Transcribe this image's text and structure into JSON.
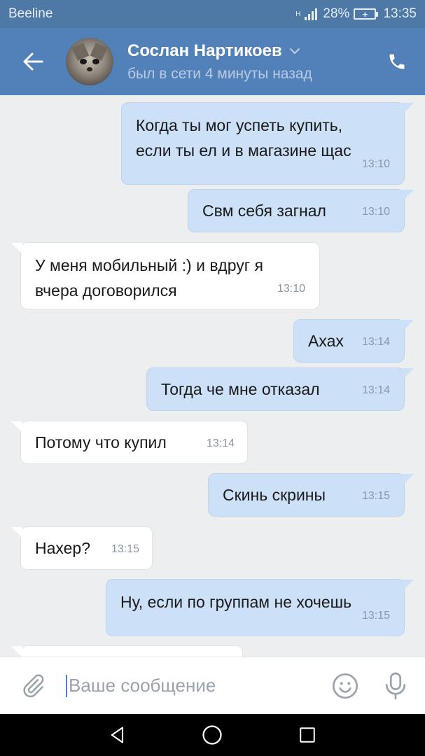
{
  "status_bar": {
    "carrier": "Beeline",
    "network": "H",
    "battery": "28%",
    "time": "13:35"
  },
  "header": {
    "contact_name": "Сослан Нартикоев",
    "contact_status": "был в сети 4 минуты назад",
    "icons": {
      "back": "arrow-left-icon",
      "dropdown": "chevron-down-icon",
      "call": "phone-icon"
    }
  },
  "messages": [
    {
      "direction": "out",
      "text_lines": [
        "Когда ты мог успеть купить,",
        "если ты ел и в магазине щас"
      ],
      "time": "13:10"
    },
    {
      "direction": "out",
      "text_lines": [
        "Свм себя загнал"
      ],
      "time": "13:10"
    },
    {
      "direction": "in",
      "text_lines": [
        "У меня мобильный :) и вдруг я",
        "вчера договорился"
      ],
      "time": "13:10"
    },
    {
      "direction": "out",
      "text_lines": [
        "Ахах"
      ],
      "time": "13:14"
    },
    {
      "direction": "out",
      "text_lines": [
        "Тогда че мне отказал"
      ],
      "time": "13:14"
    },
    {
      "direction": "in",
      "text_lines": [
        "Потому что купил"
      ],
      "time": "13:14"
    },
    {
      "direction": "out",
      "text_lines": [
        "Скинь скрины"
      ],
      "time": "13:15"
    },
    {
      "direction": "in",
      "text_lines": [
        "Нахер?"
      ],
      "time": "13:15"
    },
    {
      "direction": "out",
      "text_lines": [
        "Ну, если по группам не хочешь"
      ],
      "time": "13:15"
    }
  ],
  "composer": {
    "placeholder": "Ваше сообщение",
    "icons": {
      "attach": "paperclip-icon",
      "emoji": "smiley-icon",
      "mic": "microphone-icon"
    }
  },
  "nav_bar": {
    "icons": [
      "back-triangle-icon",
      "home-circle-icon",
      "recents-square-icon"
    ]
  },
  "colors": {
    "header": "#5181b8",
    "status_bar": "#4e78a6",
    "outgoing_bubble": "#cce0f7",
    "incoming_bubble": "#ffffff",
    "chat_background": "#edeef0"
  }
}
